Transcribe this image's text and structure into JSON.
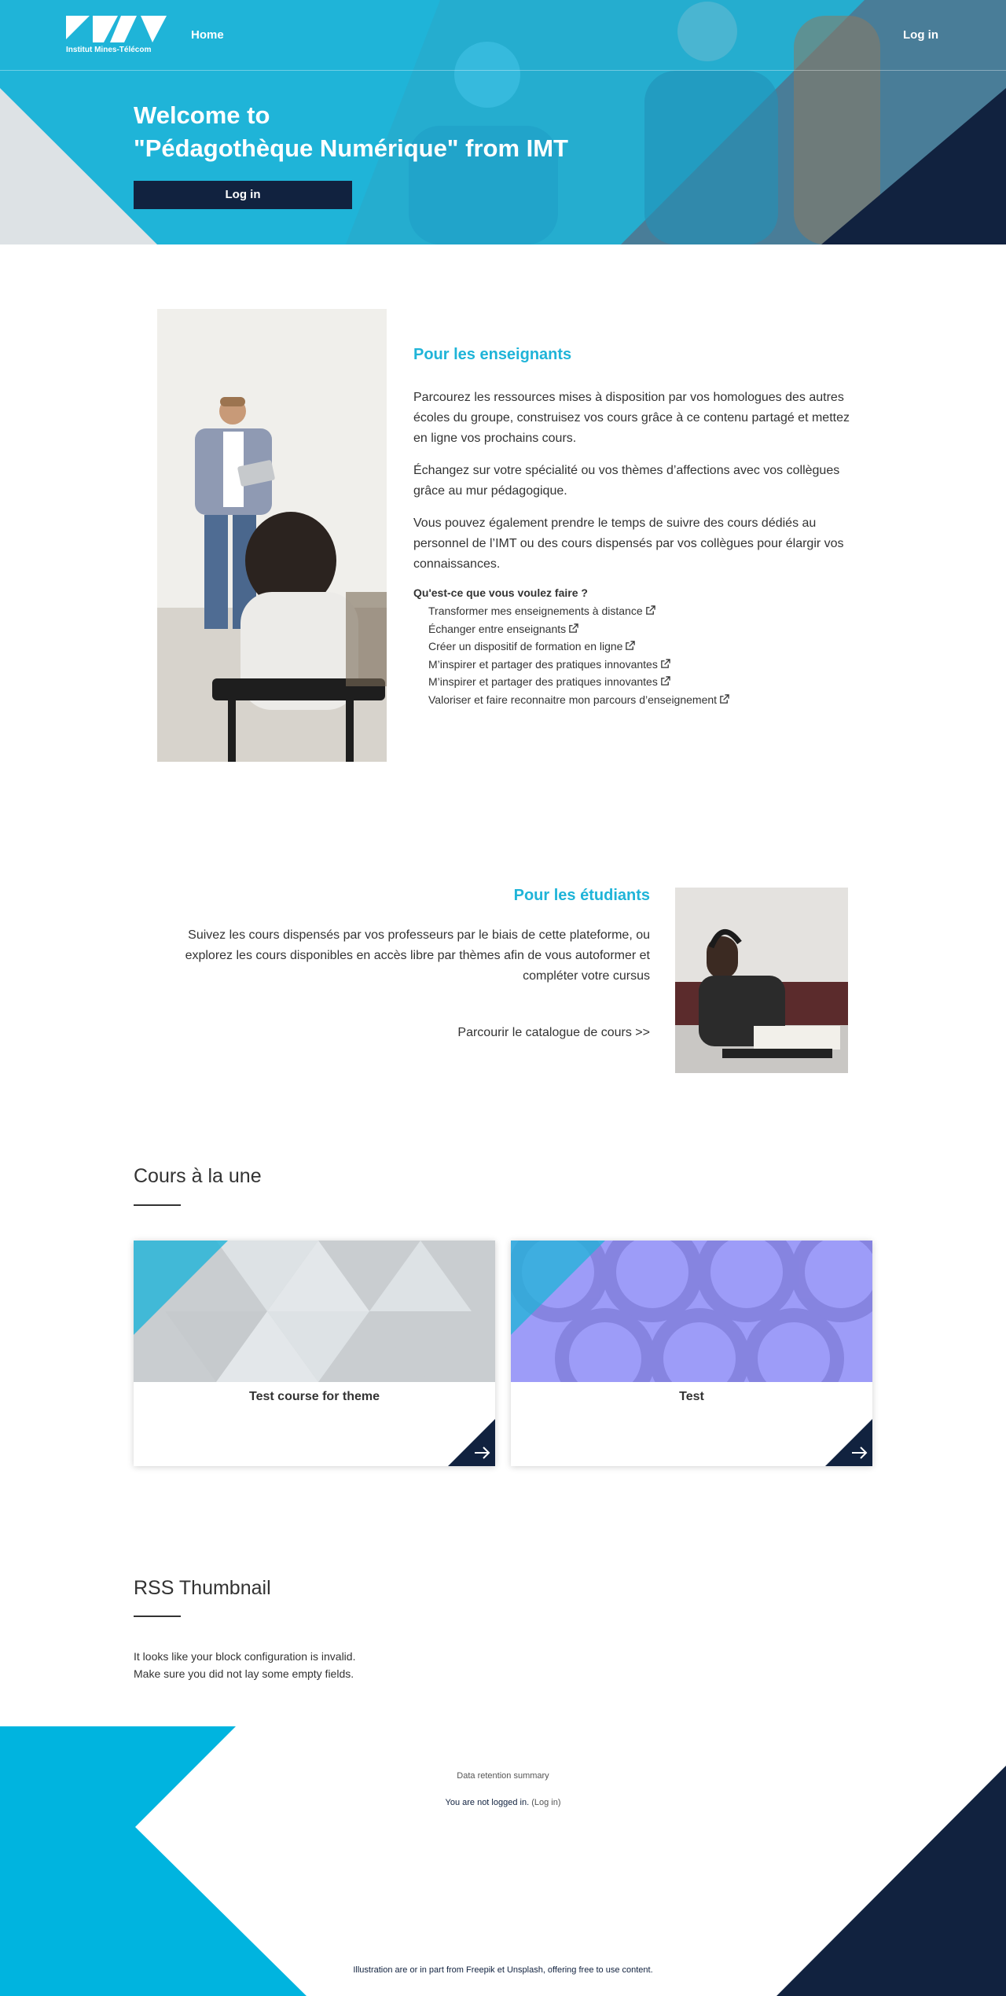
{
  "nav": {
    "logo_text": "Institut Mines-Télécom",
    "home_label": "Home",
    "login_label": "Log in"
  },
  "hero": {
    "title_line1": "Welcome to",
    "title_line2": "\"Pédagothèque Numérique\" from IMT",
    "login_button": "Log in"
  },
  "teachers": {
    "title": "Pour les enseignants",
    "paragraphs": [
      "Parcourez les ressources mises à disposition par vos homologues des autres écoles du groupe, construisez vos cours grâce à ce contenu partagé et mettez en ligne vos prochains cours.",
      "Échangez sur votre spécialité ou vos thèmes d’affections avec vos collègues grâce au mur pédagogique.",
      "Vous pouvez également prendre le temps de suivre des cours dédiés au personnel de l’IMT ou des cours dispensés par vos collègues pour élargir vos connaissances."
    ],
    "question": "Qu'est-ce que vous voulez faire ?",
    "actions": [
      "Transformer mes enseignements à distance",
      "Échanger entre enseignants",
      "Créer un dispositif de formation en ligne",
      "M’inspirer et partager des pratiques innovantes",
      "M’inspirer et partager des pratiques innovantes",
      "Valoriser et faire reconnaitre mon parcours d’enseignement"
    ]
  },
  "students": {
    "title": "Pour les étudiants",
    "text": "Suivez les cours dispensés par vos professeurs par le biais de cette plateforme, ou explorez les cours disponibles en accès libre par thèmes afin de vous autoformer et compléter votre cursus",
    "catalogue_link": "Parcourir le catalogue de cours >>"
  },
  "courses": {
    "title": "Cours à la une",
    "items": [
      {
        "name": "Test course for theme"
      },
      {
        "name": "Test"
      }
    ]
  },
  "rss": {
    "title": "RSS Thumbnail",
    "line1": "It looks like your block configuration is invalid.",
    "line2": "Make sure you did not lay some empty fields."
  },
  "footer": {
    "retention": "Data retention summary",
    "not_logged": "You are not logged in.",
    "login_link": "(Log in)",
    "credits": "Illustration are or in part from Freepik et Unsplash, offering free to use content."
  },
  "colors": {
    "cyan": "#1fb4d8",
    "navy": "#11223f",
    "light_gray": "#dde2e5"
  }
}
